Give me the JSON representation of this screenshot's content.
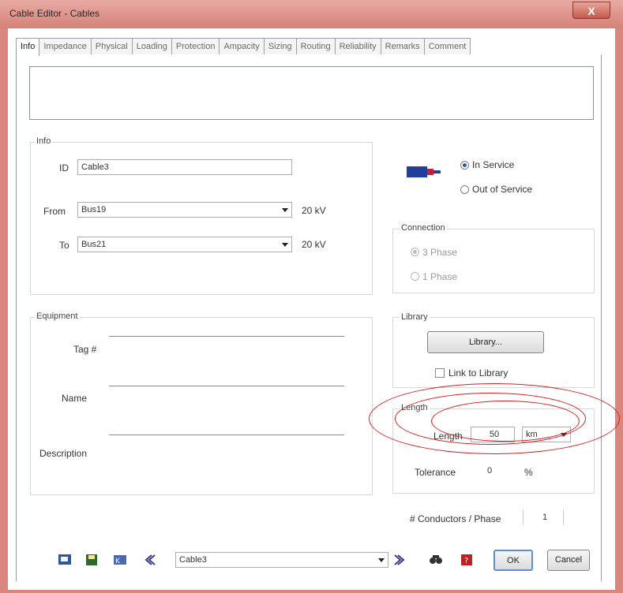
{
  "window": {
    "title": "Cable Editor - Cables",
    "close_label": "X"
  },
  "tabs": [
    {
      "label": "Info",
      "active": true
    },
    {
      "label": "Impedance"
    },
    {
      "label": "Physical"
    },
    {
      "label": "Loading"
    },
    {
      "label": "Protection"
    },
    {
      "label": "Ampacity"
    },
    {
      "label": "Sizing"
    },
    {
      "label": "Routing"
    },
    {
      "label": "Reliability"
    },
    {
      "label": "Remarks"
    },
    {
      "label": "Comment"
    }
  ],
  "info": {
    "group_title": "Info",
    "id_label": "ID",
    "id_value": "Cable3",
    "from_label": "From",
    "from_value": "Bus19",
    "from_kv": "20 kV",
    "to_label": "To",
    "to_value": "Bus21",
    "to_kv": "20 kV"
  },
  "service": {
    "in_service": "In Service",
    "out_of_service": "Out of Service",
    "selected": "In Service"
  },
  "connection": {
    "title": "Connection",
    "three_phase": "3 Phase",
    "one_phase": "1 Phase",
    "selected": "3 Phase"
  },
  "equipment": {
    "title": "Equipment",
    "tag_label": "Tag #",
    "name_label": "Name",
    "description_label": "Description"
  },
  "library": {
    "title": "Library",
    "button_label": "Library...",
    "link_label": "Link to Library"
  },
  "length": {
    "title": "Length",
    "length_label": "Length",
    "length_value": "50",
    "unit": "km",
    "tolerance_label": "Tolerance",
    "tolerance_value": "0",
    "tolerance_unit": "%"
  },
  "conductors": {
    "label": "# Conductors / Phase",
    "value": "1"
  },
  "bottom": {
    "record_value": "Cable3",
    "ok_label": "OK",
    "cancel_label": "Cancel"
  },
  "colors": {
    "titlebar": "#d58279",
    "annotation": "#d42020",
    "service_icon": "#1f3f9a"
  }
}
